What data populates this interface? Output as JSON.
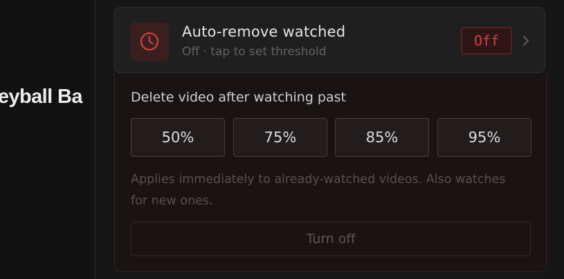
{
  "background": {
    "title": "lleyball Ba"
  },
  "setting": {
    "icon": "clock-icon",
    "title": "Auto-remove watched",
    "subtitle": "Off · tap to set threshold",
    "status": "Off",
    "accent_color": "#d2423c"
  },
  "threshold": {
    "label": "Delete video after watching past",
    "options": [
      "50%",
      "75%",
      "85%",
      "95%"
    ],
    "note": "Applies immediately to already-watched videos. Also watches for new ones.",
    "turn_off_label": "Turn off"
  }
}
